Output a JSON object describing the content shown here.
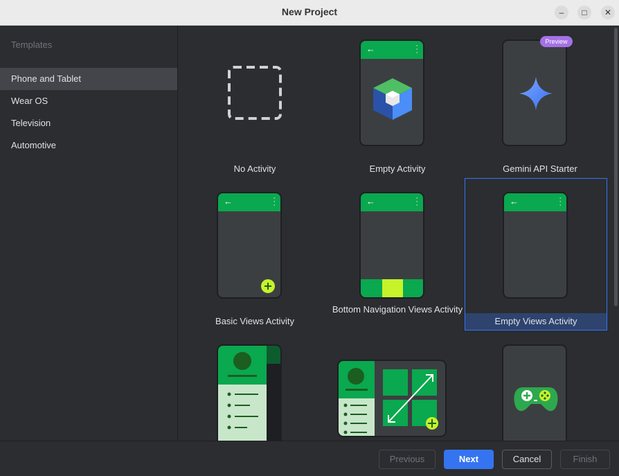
{
  "window": {
    "title": "New Project",
    "minimize_icon": "minimize-icon",
    "maximize_icon": "maximize-icon",
    "close_icon": "close-icon"
  },
  "sidebar": {
    "header": "Templates",
    "items": [
      {
        "label": "Phone and Tablet",
        "selected": true
      },
      {
        "label": "Wear OS",
        "selected": false
      },
      {
        "label": "Television",
        "selected": false
      },
      {
        "label": "Automotive",
        "selected": false
      }
    ]
  },
  "templates": [
    {
      "label": "No Activity"
    },
    {
      "label": "Empty Activity"
    },
    {
      "label": "Gemini API Starter",
      "badge": "Preview"
    },
    {
      "label": "Basic Views Activity"
    },
    {
      "label": "Bottom Navigation Views Activity"
    },
    {
      "label": "Empty Views Activity",
      "selected": true
    },
    {
      "label": ""
    },
    {
      "label": ""
    },
    {
      "label": ""
    }
  ],
  "footer": {
    "previous": "Previous",
    "next": "Next",
    "cancel": "Cancel",
    "finish": "Finish"
  },
  "colors": {
    "accent": "#3574f0",
    "android_green": "#0aa84f",
    "lime": "#c6f32a",
    "gemini_blue": "#4b8ef7",
    "preview_purple": "#a571e6"
  }
}
